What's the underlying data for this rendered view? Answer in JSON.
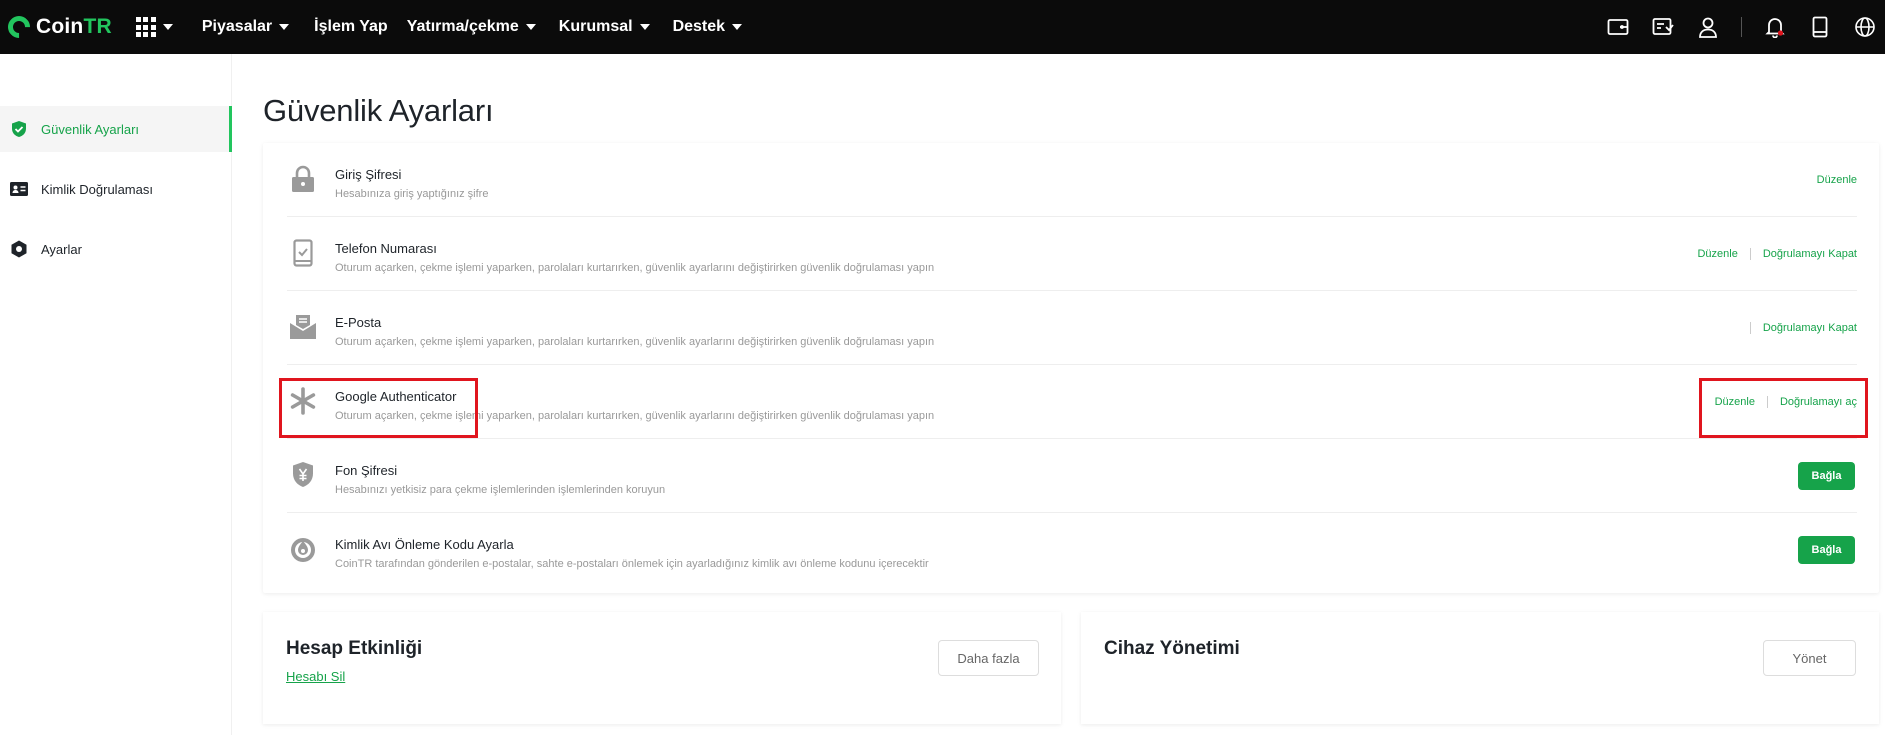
{
  "header": {
    "logo_prefix": "Coin",
    "logo_suffix": "TR",
    "nav": [
      {
        "label": "Piyasalar",
        "has_caret": true
      },
      {
        "label": "İşlem Yap",
        "has_caret": false
      },
      {
        "label": "Yatırma/çekme",
        "has_caret": true
      },
      {
        "label": "Kurumsal",
        "has_caret": true
      },
      {
        "label": "Destek",
        "has_caret": true
      }
    ],
    "right_icons": [
      "wallet-icon",
      "orders-icon",
      "user-icon",
      "bell-icon",
      "mobile-icon",
      "globe-icon"
    ],
    "accent": "#22c55e",
    "bg": "#0b0b0b"
  },
  "sidebar": {
    "items": [
      {
        "label": "Güvenlik Ayarları",
        "icon": "shield-check-icon",
        "active": true
      },
      {
        "label": "Kimlik Doğrulaması",
        "icon": "id-card-icon",
        "active": false
      },
      {
        "label": "Ayarlar",
        "icon": "settings-icon",
        "active": false
      }
    ]
  },
  "main": {
    "title": "Güvenlik Ayarları",
    "rows": [
      {
        "title": "Giriş Şifresi",
        "desc": "Hesabınıza giriş yaptığınız şifre",
        "icon": "lock-icon",
        "actions": [
          "Düzenle"
        ]
      },
      {
        "title": "Telefon Numarası",
        "desc": "Oturum açarken, çekme işlemi yaparken, parolaları kurtarırken, güvenlik ayarlarını değiştirirken güvenlik doğrulaması yapın",
        "icon": "phone-icon",
        "actions": [
          "Düzenle",
          "Doğrulamayı Kapat"
        ]
      },
      {
        "title": "E-Posta",
        "desc": "Oturum açarken, çekme işlemi yaparken, parolaları kurtarırken, güvenlik ayarlarını değiştirirken güvenlik doğrulaması yapın",
        "icon": "mail-icon",
        "actions": [
          "Doğrulamayı Kapat"
        ]
      },
      {
        "title": "Google Authenticator",
        "desc": "Oturum açarken, çekme işlemi yaparken, parolaları kurtarırken, güvenlik ayarlarını değiştirirken güvenlik doğrulaması yapın",
        "icon": "asterisk-icon",
        "actions": [
          "Düzenle",
          "Doğrulamayı aç"
        ]
      },
      {
        "title": "Fon Şifresi",
        "desc": "Hesabınızı yetkisiz para çekme işlemlerinden işlemlerinden koruyun",
        "icon": "shield-yen-icon",
        "button": "Bağla"
      },
      {
        "title": "Kimlik Avı Önleme Kodu Ayarla",
        "desc": "CoinTR tarafından gönderilen e-postalar, sahte e-postaları önlemek için ayarladığınız kimlik avı önleme kodunu içerecektir",
        "icon": "anti-phishing-icon",
        "button": "Bağla"
      }
    ]
  },
  "activity": {
    "title": "Hesap Etkinliği",
    "link": "Hesabı Sil",
    "button": "Daha fazla"
  },
  "devices": {
    "title": "Cihaz Yönetimi",
    "button": "Yönet"
  }
}
